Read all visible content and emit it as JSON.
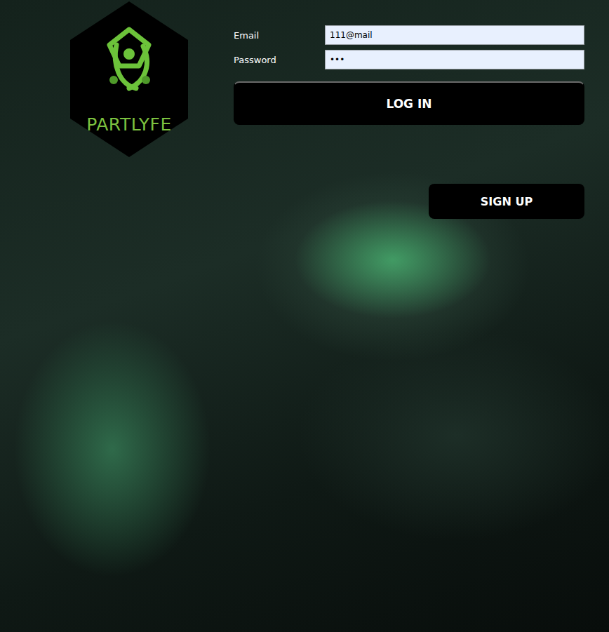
{
  "logo": {
    "text": "PARTLYFE"
  },
  "form": {
    "fields": [
      {
        "label": "Email",
        "value": "111@mail"
      },
      {
        "label": "Password",
        "value": "•••"
      }
    ]
  },
  "login_button": {
    "label": "LOG IN"
  },
  "signup_button": {
    "label": "SIGN UP"
  }
}
